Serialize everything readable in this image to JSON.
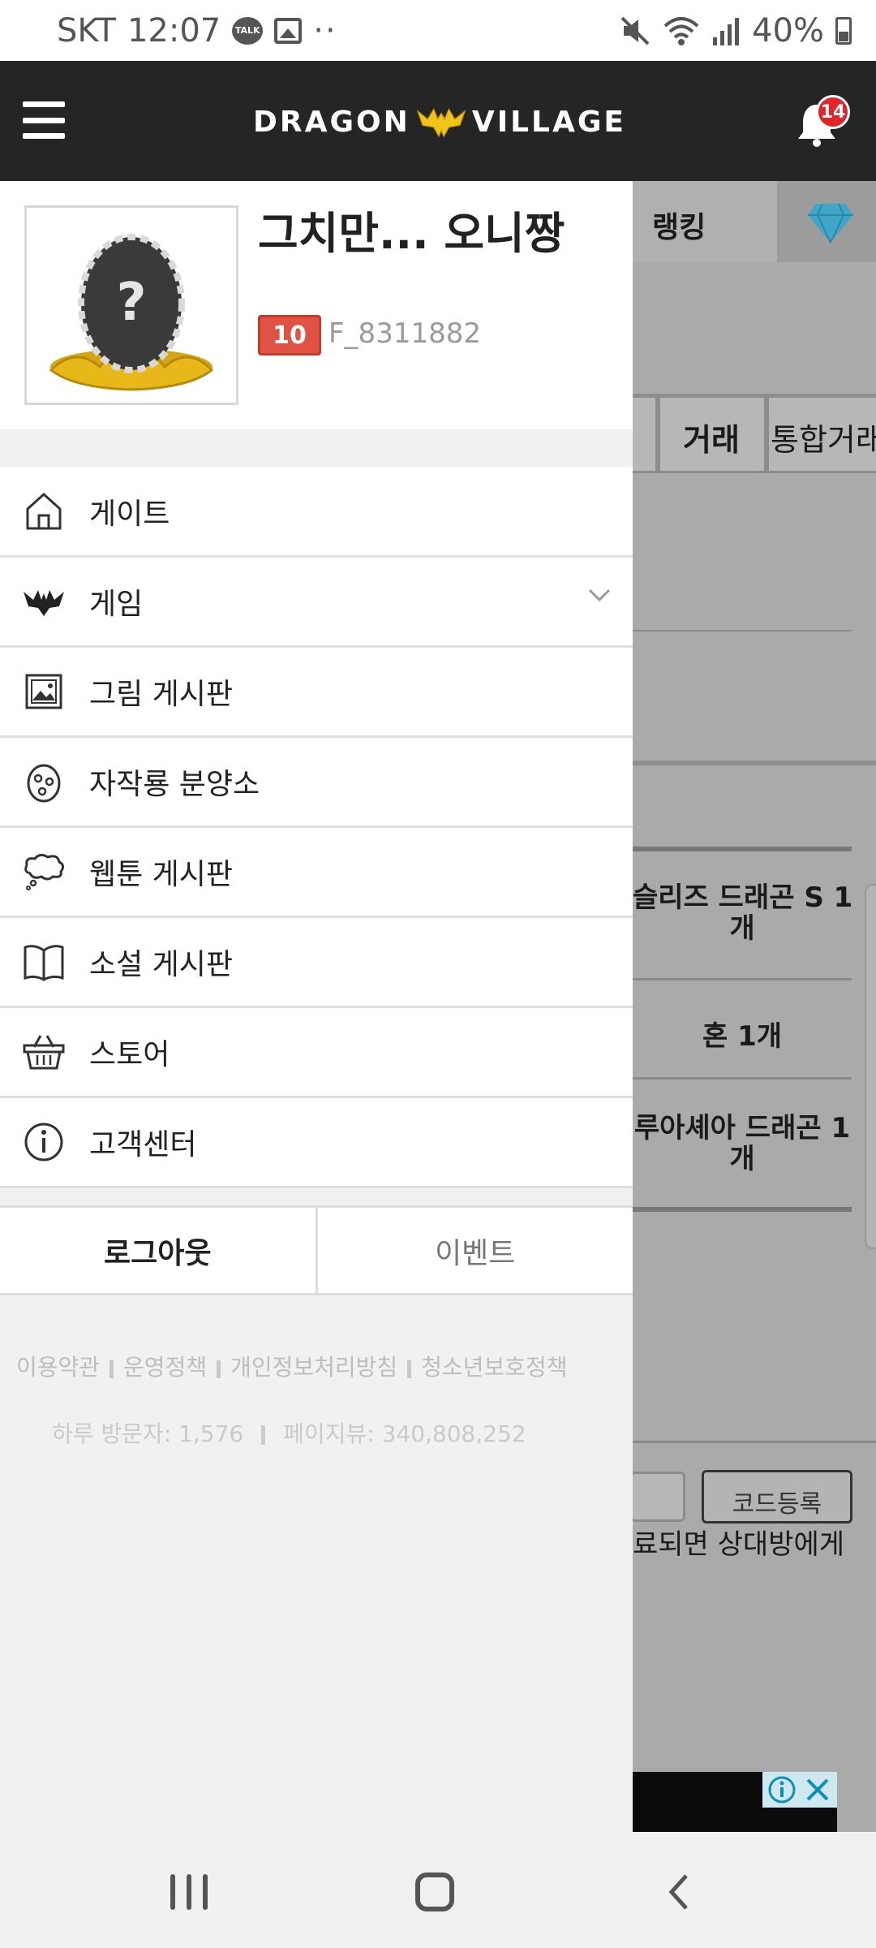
{
  "status_bar": {
    "carrier": "SKT",
    "time": "12:07",
    "talk_icon_text": "TALK",
    "extra": "··",
    "battery": "40%"
  },
  "header": {
    "logo_left": "DRAGON",
    "logo_right": "VILLAGE",
    "notification_count": "14"
  },
  "profile": {
    "nickname": "그치만... 오니짱",
    "level": "10",
    "user_id": "F_8311882"
  },
  "menu": {
    "items": [
      {
        "label": "게이트",
        "icon": "home-icon"
      },
      {
        "label": "게임",
        "icon": "dragon-icon"
      },
      {
        "label": "그림 게시판",
        "icon": "picture-icon"
      },
      {
        "label": "자작룡 분양소",
        "icon": "egg-icon"
      },
      {
        "label": "웹툰 게시판",
        "icon": "thought-bubble-icon"
      },
      {
        "label": "소설 게시판",
        "icon": "book-icon"
      },
      {
        "label": "스토어",
        "icon": "basket-icon"
      },
      {
        "label": "고객센터",
        "icon": "info-icon"
      }
    ]
  },
  "actions": {
    "logout": "로그아웃",
    "event": "이벤트"
  },
  "footer": {
    "links": [
      "이용약관",
      "운영정책",
      "개인정보처리방침",
      "청소년보호정책"
    ],
    "daily_visitors": "하루 방문자: 1,576",
    "page_views": "페이지뷰: 340,808,252"
  },
  "background_page": {
    "ranking_tab": "랭킹",
    "trade_tab": "거래",
    "integrated_trade_tab": "통합거래",
    "row1_line1": "슬리즈 드래곤 S 1",
    "row1_line2": "개",
    "row2": "혼 1개",
    "row3_line1": "루아셰아 드래곤 1",
    "row3_line2": "개",
    "code_button": "코드등록",
    "partial_text": "료되면 상대방에게"
  }
}
